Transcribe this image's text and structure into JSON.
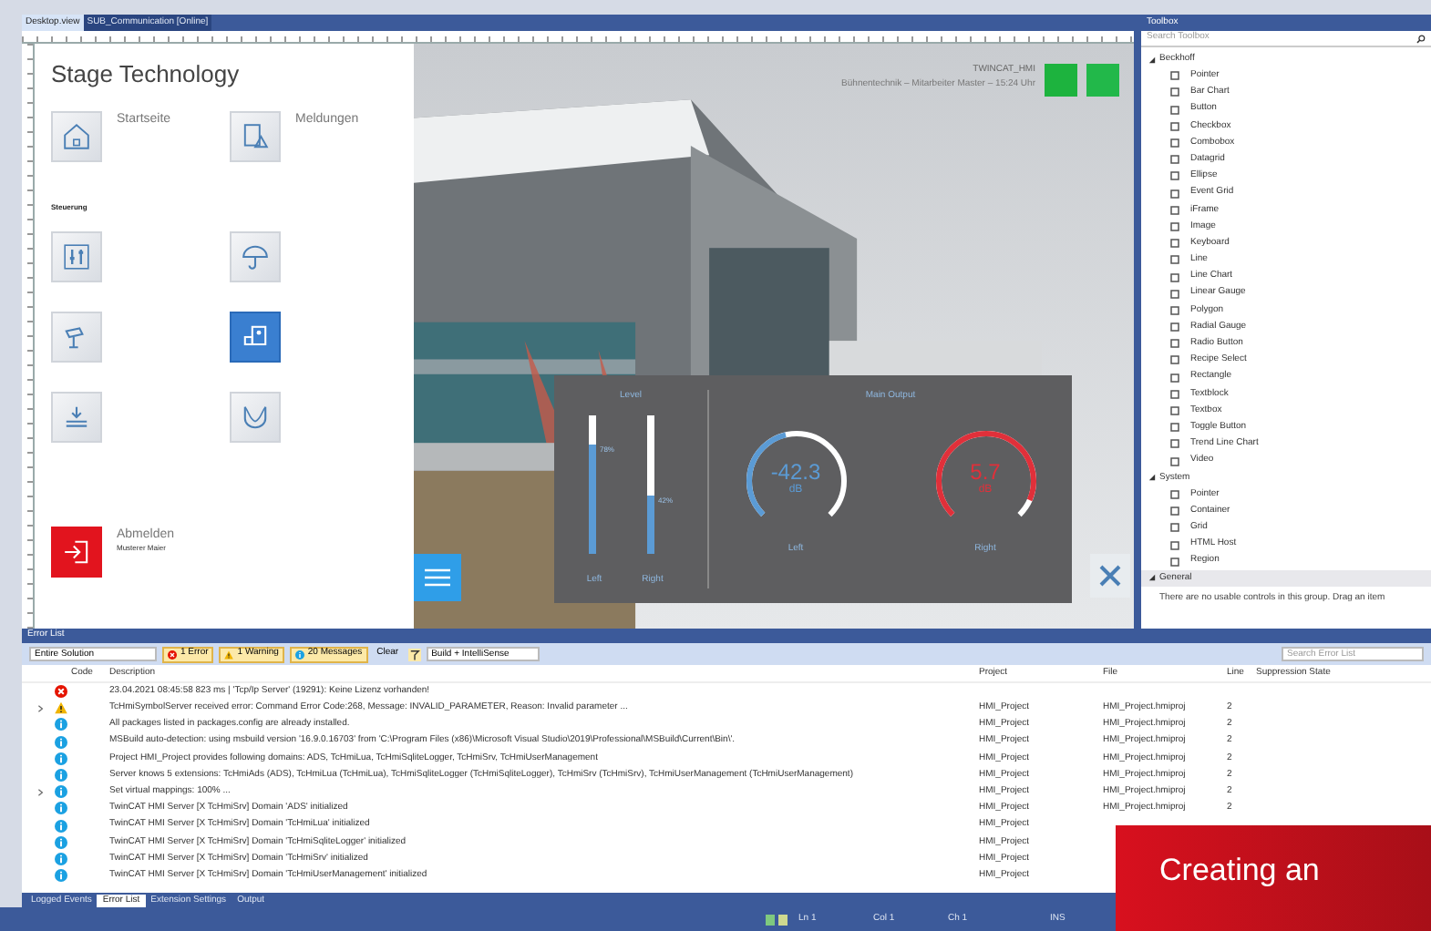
{
  "designer": {
    "tabs": [
      {
        "label": "Desktop.view",
        "selected": true
      },
      {
        "label": "SUB_Communication [Online]",
        "selected": false
      }
    ],
    "hmi": {
      "title": "Stage Technology",
      "nav": [
        {
          "label": "Startseite"
        },
        {
          "label": "Meldungen"
        }
      ],
      "section": "Steuerung",
      "tiles": [
        {
          "selected": false
        },
        {
          "selected": false
        },
        {
          "selected": false
        },
        {
          "selected": true
        },
        {
          "selected": false
        },
        {
          "selected": false
        }
      ],
      "logout": {
        "label": "Abmelden",
        "user": "Musterer Maier"
      },
      "header": {
        "system": "TWINCAT_HMI",
        "status": "Bühnentechnik – Mitarbeiter Master – 15:24 Uhr"
      },
      "level_panel": {
        "title": "Level",
        "bars": [
          {
            "level": 0.78,
            "reading": "78%",
            "label": "Left"
          },
          {
            "level": 0.42,
            "reading": "42%",
            "label": "Right"
          }
        ]
      },
      "output_panel": {
        "title": "Main Output",
        "gauges": [
          {
            "value": "-42.3",
            "unit": "dB",
            "label": "Left",
            "level": 0.45,
            "color": "#5b9bd5"
          },
          {
            "value": "5.7",
            "unit": "dB",
            "label": "Right",
            "level": 0.92,
            "color": "#e0303a"
          }
        ]
      }
    }
  },
  "toolbox": {
    "title": "Toolbox",
    "search": {
      "placeholder": "Search Toolbox"
    },
    "groups": [
      {
        "name": "Beckhoff",
        "expanded": true,
        "items": [
          "Pointer",
          "Bar Chart",
          "Button",
          "Checkbox",
          "Combobox",
          "Datagrid",
          "Ellipse",
          "Event Grid",
          "iFrame",
          "Image",
          "Keyboard",
          "Line",
          "Line Chart",
          "Linear Gauge",
          "Polygon",
          "Radial Gauge",
          "Radio Button",
          "Recipe Select",
          "Rectangle",
          "Textblock",
          "Textbox",
          "Toggle Button",
          "Trend Line Chart",
          "Video"
        ]
      },
      {
        "name": "System",
        "expanded": true,
        "items": [
          "Pointer",
          "Container",
          "Grid",
          "HTML Host",
          "Region"
        ]
      },
      {
        "name": "General",
        "expanded": true,
        "note": "There are no usable controls in this group. Drag an item"
      }
    ]
  },
  "error_list": {
    "title": "Error List",
    "scope": "Entire Solution",
    "filters": [
      {
        "kind": "error",
        "label": "1 Error",
        "selected": true
      },
      {
        "kind": "warning",
        "label": "1 Warning",
        "selected": true
      },
      {
        "kind": "info",
        "label": "20 Messages",
        "selected": true
      }
    ],
    "clear": "Clear",
    "source": "Build + IntelliSense",
    "search": {
      "placeholder": "Search Error List"
    },
    "columns": [
      "Code",
      "Description",
      "Project",
      "File",
      "Line",
      "Suppression State"
    ],
    "rows": [
      {
        "kind": "error",
        "expandable": false,
        "description": "23.04.2021 08:45:58 823 ms | 'Tcp/Ip Server' (19291): Keine Lizenz vorhanden!"
      },
      {
        "kind": "warning",
        "expandable": true,
        "description": "TcHmiSymbolServer received error: Command Error Code:268, Message: INVALID_PARAMETER, Reason: Invalid parameter ...",
        "project": "HMI_Project",
        "file": "HMI_Project.hmiproj",
        "line": "2"
      },
      {
        "kind": "info",
        "expandable": false,
        "description": "All packages listed in packages.config are already installed.",
        "project": "HMI_Project",
        "file": "HMI_Project.hmiproj",
        "line": "2"
      },
      {
        "kind": "info",
        "expandable": false,
        "description": "MSBuild auto-detection: using msbuild version '16.9.0.16703' from 'C:\\Program Files (x86)\\Microsoft Visual Studio\\2019\\Professional\\MSBuild\\Current\\Bin\\'.",
        "project": "HMI_Project",
        "file": "HMI_Project.hmiproj",
        "line": "2"
      },
      {
        "kind": "info",
        "expandable": false,
        "description": "Project HMI_Project provides following domains: ADS, TcHmiLua, TcHmiSqliteLogger, TcHmiSrv, TcHmiUserManagement",
        "project": "HMI_Project",
        "file": "HMI_Project.hmiproj",
        "line": "2"
      },
      {
        "kind": "info",
        "expandable": false,
        "description": "Server knows 5 extensions: TcHmiAds (ADS), TcHmiLua (TcHmiLua), TcHmiSqliteLogger (TcHmiSqliteLogger), TcHmiSrv (TcHmiSrv), TcHmiUserManagement (TcHmiUserManagement)",
        "project": "HMI_Project",
        "file": "HMI_Project.hmiproj",
        "line": "2"
      },
      {
        "kind": "info",
        "expandable": true,
        "description": "Set virtual mappings: 100% ...",
        "project": "HMI_Project",
        "file": "HMI_Project.hmiproj",
        "line": "2"
      },
      {
        "kind": "info",
        "expandable": false,
        "description": "TwinCAT HMI Server [X TcHmiSrv] Domain 'ADS' initialized",
        "project": "HMI_Project",
        "file": "HMI_Project.hmiproj",
        "line": "2"
      },
      {
        "kind": "info",
        "expandable": false,
        "description": "TwinCAT HMI Server [X TcHmiSrv] Domain 'TcHmiLua' initialized",
        "project": "HMI_Project"
      },
      {
        "kind": "info",
        "expandable": false,
        "description": "TwinCAT HMI Server [X TcHmiSrv] Domain 'TcHmiSqliteLogger' initialized",
        "project": "HMI_Project"
      },
      {
        "kind": "info",
        "expandable": false,
        "description": "TwinCAT HMI Server [X TcHmiSrv] Domain 'TcHmiSrv' initialized",
        "project": "HMI_Project"
      },
      {
        "kind": "info",
        "expandable": false,
        "description": "TwinCAT HMI Server [X TcHmiSrv] Domain 'TcHmiUserManagement' initialized",
        "project": "HMI_Project"
      }
    ],
    "tabs": [
      {
        "label": "Logged Events",
        "selected": false
      },
      {
        "label": "Error List",
        "selected": true
      },
      {
        "label": "Extension Settings",
        "selected": false
      },
      {
        "label": "Output",
        "selected": false
      }
    ]
  },
  "status_bar": {
    "line": "Ln 1",
    "column": "Col 1",
    "char": "Ch 1",
    "mode": "INS"
  },
  "banner": {
    "text": "Creating an"
  }
}
